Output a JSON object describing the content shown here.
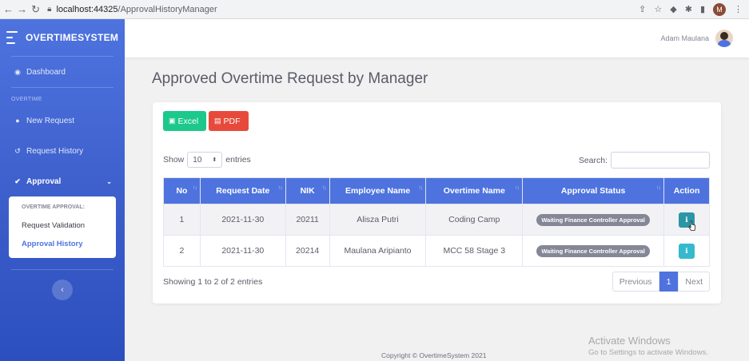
{
  "browser": {
    "url_host": "localhost:44325",
    "url_path": "/ApprovalHistoryManager",
    "profile_initial": "M"
  },
  "sidebar": {
    "brand": "OVERTIMESYSTEM",
    "dashboard": "Dashboard",
    "section_overtime": "OVERTIME",
    "new_request": "New Request",
    "request_history": "Request History",
    "approval": "Approval",
    "collapse_header": "OVERTIME APPROVAL:",
    "request_validation": "Request Validation",
    "approval_history": "Approval History",
    "toggle_icon": "‹"
  },
  "topbar": {
    "user_name": "Adam Maulana"
  },
  "main": {
    "title": "Approved Overtime Request by Manager",
    "excel_label": "Excel",
    "pdf_label": "PDF",
    "show_label": "Show",
    "entries_value": "10",
    "entries_label": "entries",
    "search_label": "Search:",
    "search_value": ""
  },
  "table": {
    "headers": [
      "No",
      "Request Date",
      "NIK",
      "Employee Name",
      "Overtime Name",
      "Approval Status",
      "Action"
    ],
    "rows": [
      {
        "no": "1",
        "date": "2021-11-30",
        "nik": "20211",
        "name": "Alisza Putri",
        "overtime": "Coding Camp",
        "status": "Waiting Finance Controller Approval"
      },
      {
        "no": "2",
        "date": "2021-11-30",
        "nik": "20214",
        "name": "Maulana Aripianto",
        "overtime": "MCC 58 Stage 3",
        "status": "Waiting Finance Controller Approval"
      }
    ]
  },
  "pagination": {
    "info": "Showing 1 to 2 of 2 entries",
    "previous": "Previous",
    "current": "1",
    "next": "Next"
  },
  "footer": {
    "copyright": "Copyright © OvertimeSystem 2021"
  },
  "windows_watermark": {
    "line1": "Activate Windows",
    "line2": "Go to Settings to activate Windows."
  },
  "colors": {
    "primary": "#4e73df",
    "success": "#1cc88a",
    "danger": "#e74a3b",
    "info": "#36b9cc",
    "secondary": "#858796"
  }
}
